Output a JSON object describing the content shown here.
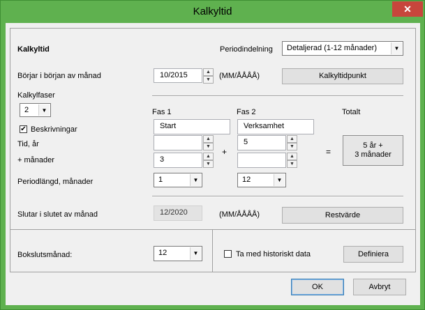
{
  "window": {
    "title": "Kalkyltid",
    "close_glyph": "✕"
  },
  "header": {
    "section_title": "Kalkyltid",
    "period_label": "Periodindelning",
    "period_value": "Detaljerad (1-12 månader)"
  },
  "start": {
    "label": "Börjar i början av månad",
    "value": "10/2015",
    "format": "(MM/ÅÅÅÅ)",
    "button": "Kalkyltidpunkt"
  },
  "phases": {
    "label": "Kalkylfaser",
    "count": "2",
    "descriptions_label": "Beskrivningar",
    "descriptions_checked": "✔",
    "phase1_header": "Fas 1",
    "phase2_header": "Fas 2",
    "total_header": "Totalt",
    "phase1_desc": "Start",
    "phase2_desc": "Verksamhet",
    "time_years_label": "Tid, år",
    "plus_months_label": "+ månader",
    "phase1_years": "",
    "phase1_months": "3",
    "phase2_years": "5",
    "phase2_months": "",
    "plus": "+",
    "equals": "=",
    "total_line1": "5 år +",
    "total_line2": "3 månader",
    "period_length_label": "Periodlängd, månader",
    "phase1_period": "1",
    "phase2_period": "12"
  },
  "end": {
    "label": "Slutar i slutet av månad",
    "value": "12/2020",
    "format": "(MM/ÅÅÅÅ)",
    "button": "Restvärde"
  },
  "closing": {
    "label": "Bokslutsmånad:",
    "value": "12",
    "history_label": "Ta med historiskt data",
    "define_button": "Definiera"
  },
  "footer": {
    "ok": "OK",
    "cancel": "Avbryt"
  }
}
